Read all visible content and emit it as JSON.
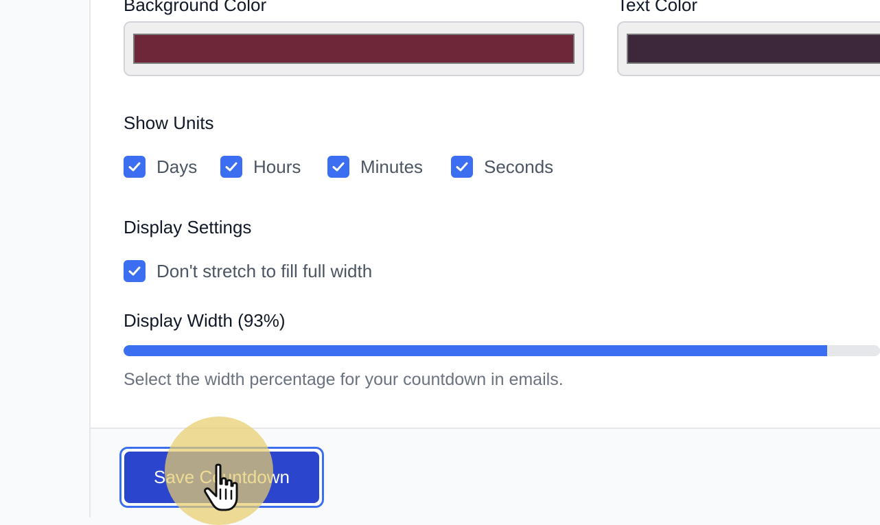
{
  "colors": {
    "accent": "#3b6ef0",
    "button": "#2b46cc",
    "checkbox": "#3b6ef0",
    "background_swatch": "#6e2639",
    "text_swatch": "#3c283a",
    "halo": "#e6cd6e"
  },
  "style": {
    "background_color_label": "Background Color",
    "text_color_label": "Text Color",
    "background_color_value": "#6e2639",
    "text_color_value": "#3c283a"
  },
  "units": {
    "title": "Show Units",
    "options": [
      {
        "label": "Days",
        "checked": true
      },
      {
        "label": "Hours",
        "checked": true
      },
      {
        "label": "Minutes",
        "checked": true
      },
      {
        "label": "Seconds",
        "checked": true
      }
    ]
  },
  "display": {
    "title": "Display Settings",
    "no_stretch_label": "Don't stretch to fill full width",
    "no_stretch_checked": true,
    "width_label": "Display Width (93%)",
    "width_percent": 93,
    "helper": "Select the width percentage for your countdown in emails."
  },
  "footer": {
    "save_label": "Save Countdown"
  },
  "icons": {
    "checkbox_icon": "check-icon",
    "cursor_icon": "hand-pointer-icon"
  }
}
